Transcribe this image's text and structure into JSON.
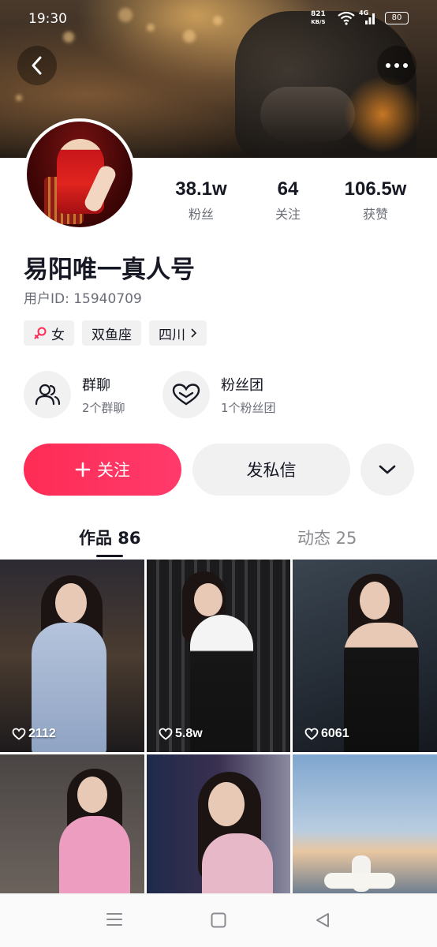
{
  "status_bar": {
    "time": "19:30",
    "net_speed": "821",
    "net_unit": "KB/S",
    "signal_label": "4G",
    "battery": "80"
  },
  "profile": {
    "stats": [
      {
        "value": "38.1w",
        "label": "粉丝"
      },
      {
        "value": "64",
        "label": "关注"
      },
      {
        "value": "106.5w",
        "label": "获赞"
      }
    ],
    "name": "易阳唯一真人号",
    "user_id": "用户ID: 15940709",
    "tags": {
      "gender": "女",
      "zodiac": "双鱼座",
      "location": "四川"
    },
    "groups": [
      {
        "title": "群聊",
        "subtitle": "2个群聊",
        "icon": "group-icon"
      },
      {
        "title": "粉丝团",
        "subtitle": "1个粉丝团",
        "icon": "heart-icon"
      }
    ]
  },
  "actions": {
    "follow_label": "关注",
    "message_label": "发私信"
  },
  "tabs": [
    {
      "label": "作品 86",
      "active": true
    },
    {
      "label": "动态 25",
      "active": false
    }
  ],
  "videos": [
    {
      "likes": "2112"
    },
    {
      "likes": "5.8w"
    },
    {
      "likes": "6061"
    },
    {
      "likes": ""
    },
    {
      "likes": ""
    },
    {
      "likes": ""
    }
  ],
  "colors": {
    "accent": "#fe2c55",
    "text_primary": "#161823",
    "text_secondary": "#6b6d77",
    "chip_bg": "#f1f1f2"
  }
}
